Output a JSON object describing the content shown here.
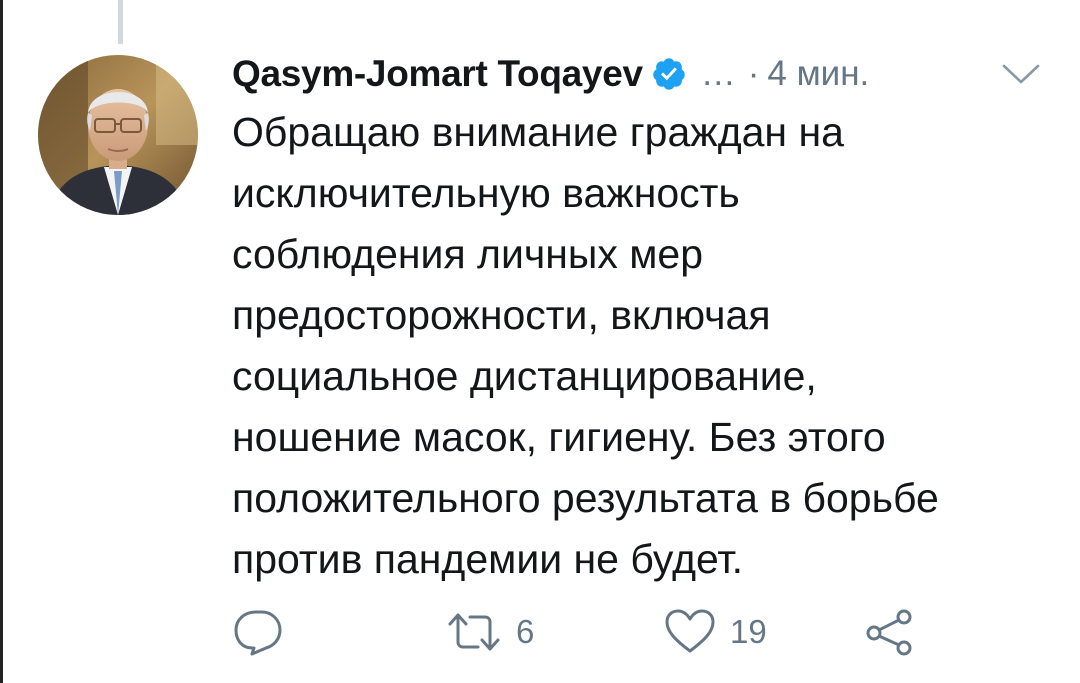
{
  "tweet": {
    "author_name": "Qasym-Jomart Toqayev",
    "verified": true,
    "handle_truncated": "…",
    "separator": "·",
    "time_ago": "4 мин.",
    "text_lines": [
      "Обращаю внимание граждан на",
      "исключительную важность",
      "соблюдения личных мер",
      "предосторожности, включая",
      "социальное дистанцирование,",
      "ношение масок, гигиену. Без этого",
      "положительного результата в борьбе",
      "против пандемии не будет."
    ],
    "actions": {
      "reply_count": "",
      "retweet_count": "6",
      "like_count": "19"
    }
  },
  "icons": {
    "verified": "verified-badge-icon",
    "menu": "chevron-down-icon",
    "reply": "reply-icon",
    "retweet": "retweet-icon",
    "like": "heart-icon",
    "share": "share-icon"
  },
  "colors": {
    "text": "#14171a",
    "secondary": "#657786",
    "verified_blue": "#1da1f2",
    "thread_line": "#cfd9de"
  }
}
